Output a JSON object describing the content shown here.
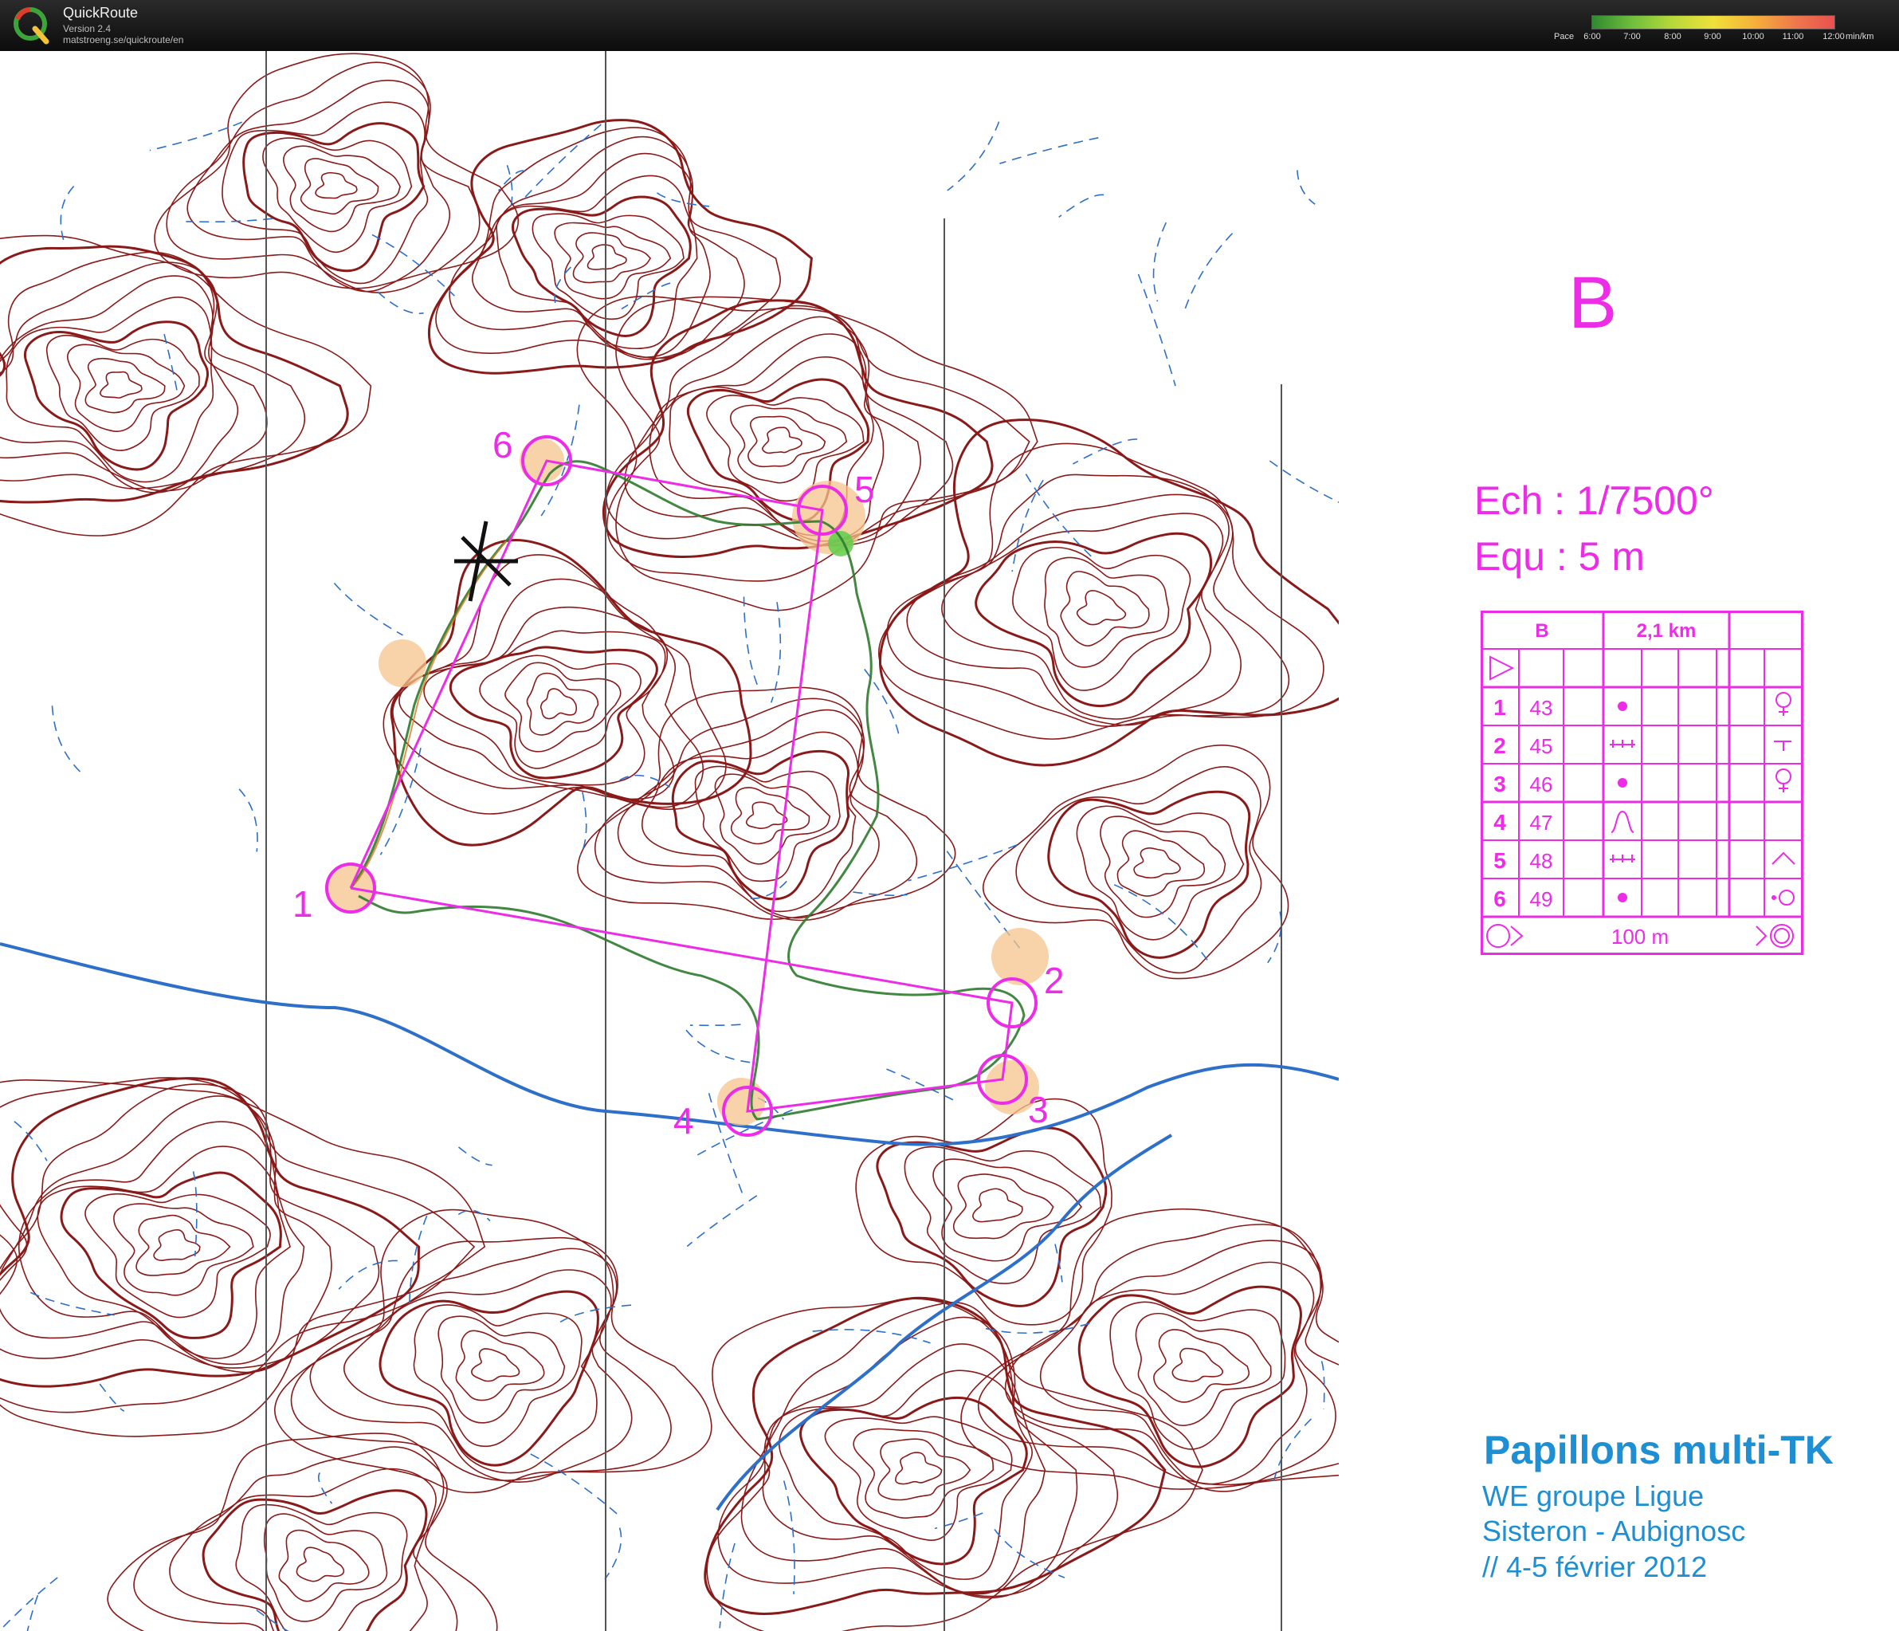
{
  "header": {
    "app_name": "QuickRoute",
    "version": "Version 2.4",
    "url": "matstroeng.se/quickroute/en",
    "pace_label": "Pace",
    "pace_ticks": [
      "6:00",
      "7:00",
      "8:00",
      "9:00",
      "10:00",
      "11:00",
      "12:00"
    ],
    "pace_unit": "min/km"
  },
  "map": {
    "course_letter": "B",
    "scale": "Ech : 1/7500°",
    "equidistance": "Equ : 5 m",
    "control_labels": [
      "1",
      "2",
      "3",
      "4",
      "5",
      "6"
    ],
    "colors": {
      "contour": "#8a1a1a",
      "water": "#2d6fc9",
      "course": "#ec2ce6",
      "route_green": "#2f7a2f",
      "route_orange": "#d9791e"
    }
  },
  "course_table": {
    "header": {
      "course": "B",
      "length": "2,1 km"
    },
    "rows": [
      {
        "num": "1",
        "code": "43"
      },
      {
        "num": "2",
        "code": "45"
      },
      {
        "num": "3",
        "code": "46"
      },
      {
        "num": "4",
        "code": "47"
      },
      {
        "num": "5",
        "code": "48"
      },
      {
        "num": "6",
        "code": "49"
      }
    ],
    "footer": "100 m"
  },
  "event": {
    "title": "Papillons multi-TK",
    "line1": "WE groupe Ligue",
    "line2": "Sisteron - Aubignosc",
    "line3": "// 4-5 février 2012"
  }
}
